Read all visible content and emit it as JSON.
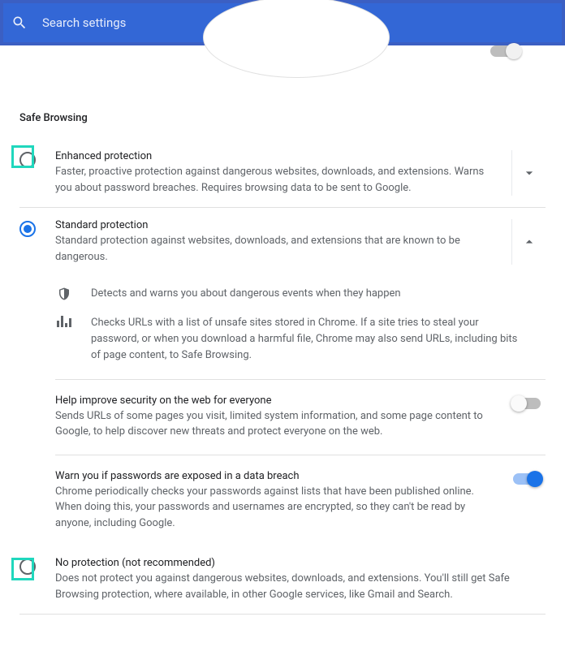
{
  "search": {
    "placeholder": "Search settings"
  },
  "section": {
    "title": "Safe Browsing"
  },
  "options": {
    "enhanced": {
      "title": "Enhanced protection",
      "desc": "Faster, proactive protection against dangerous websites, downloads, and extensions. Warns you about password breaches. Requires browsing data to be sent to Google."
    },
    "standard": {
      "title": "Standard protection",
      "desc": "Standard protection against websites, downloads, and extensions that are known to be dangerous."
    },
    "none": {
      "title": "No protection (not recommended)",
      "desc": "Does not protect you against dangerous websites, downloads, and extensions. You'll still get Safe Browsing protection, where available, in other Google services, like Gmail and Search."
    }
  },
  "details": {
    "d1": "Detects and warns you about dangerous events when they happen",
    "d2": "Checks URLs with a list of unsafe sites stored in Chrome. If a site tries to steal your password, or when you download a harmful file, Chrome may also send URLs, including bits of page content, to Safe Browsing."
  },
  "sub": {
    "improve": {
      "title": "Help improve security on the web for everyone",
      "desc": "Sends URLs of some pages you visit, limited system information, and some page content to Google, to help discover new threats and protect everyone on the web."
    },
    "passwords": {
      "title": "Warn you if passwords are exposed in a data breach",
      "desc": "Chrome periodically checks your passwords against lists that have been published online. When doing this, your passwords and usernames are encrypted, so they can't be read by anyone, including Google."
    }
  }
}
